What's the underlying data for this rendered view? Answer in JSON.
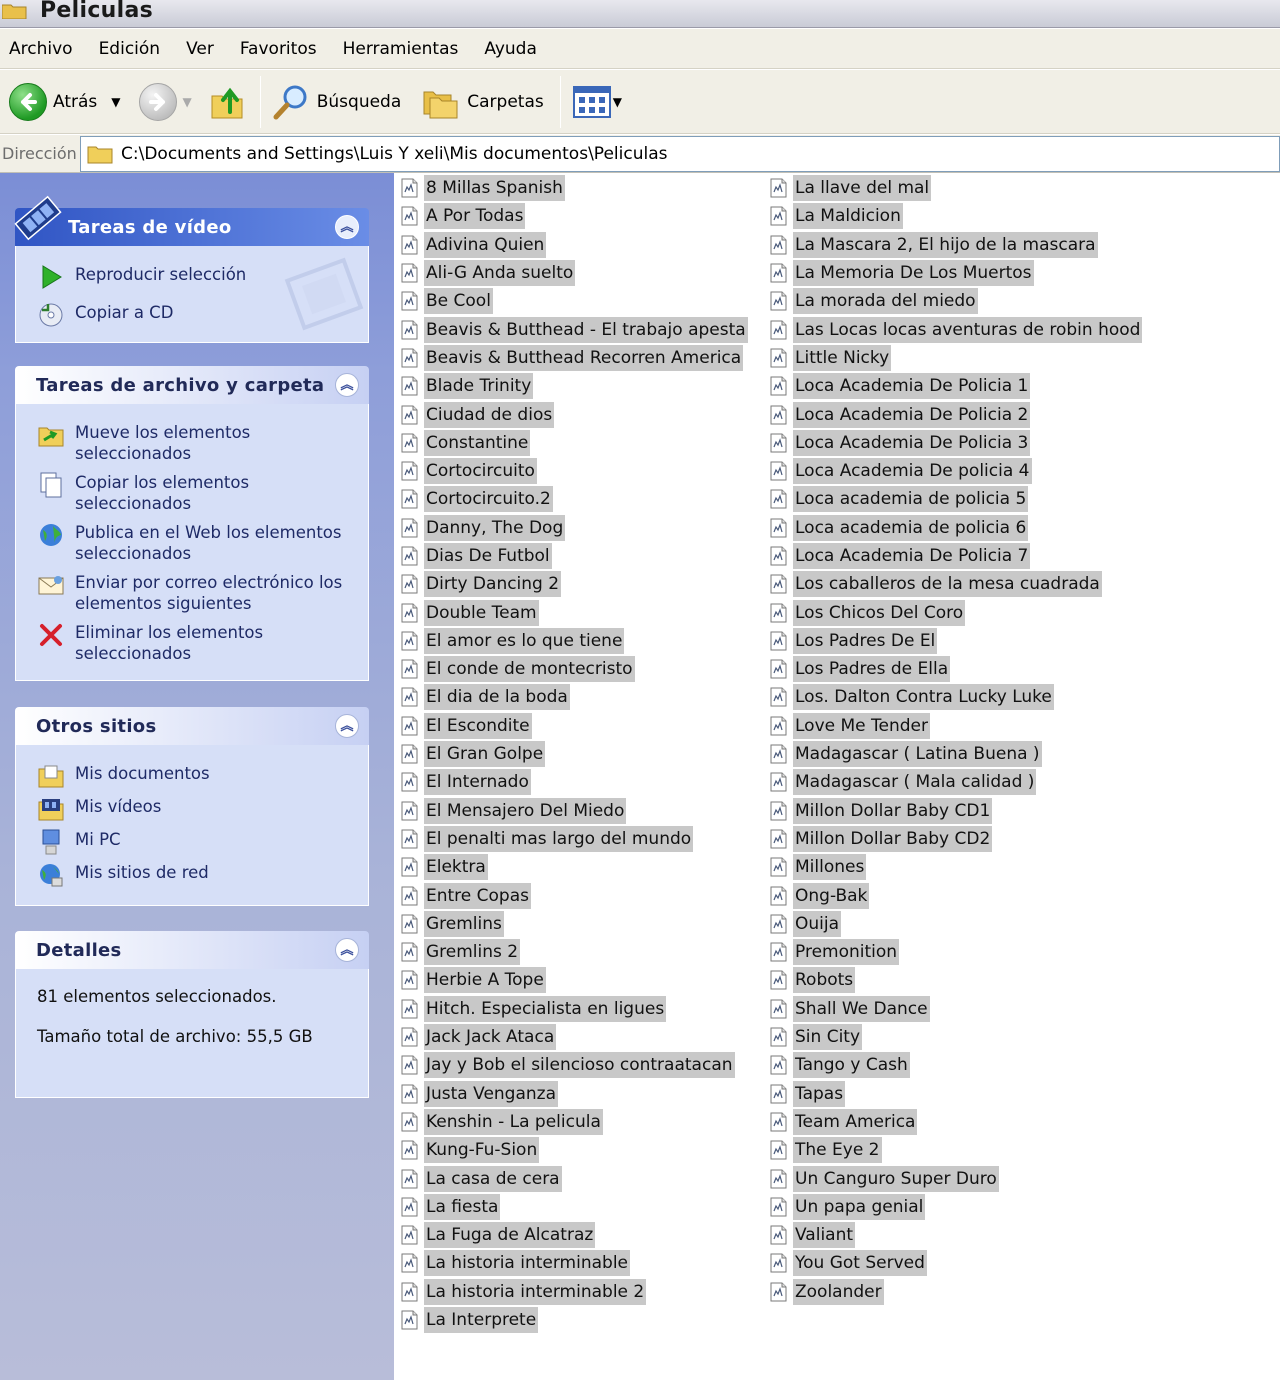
{
  "window": {
    "title": "Peliculas"
  },
  "menu": [
    "Archivo",
    "Edición",
    "Ver",
    "Favoritos",
    "Herramientas",
    "Ayuda"
  ],
  "toolbar": {
    "back_label": "Atrás",
    "search_label": "Búsqueda",
    "folders_label": "Carpetas"
  },
  "address": {
    "label": "Dirección",
    "path": "C:\\Documents and Settings\\Luis Y xeli\\Mis documentos\\Peliculas"
  },
  "panels": {
    "video": {
      "title": "Tareas de vídeo",
      "items": [
        "Reproducir selección",
        "Copiar a CD"
      ]
    },
    "file_tasks": {
      "title": "Tareas de archivo y carpeta",
      "items": [
        "Mueve los elementos seleccionados",
        "Copiar los elementos seleccionados",
        "Publica en el Web los elementos seleccionados",
        "Enviar por correo electrónico los elementos siguientes",
        "Eliminar los elementos seleccionados"
      ]
    },
    "other": {
      "title": "Otros sitios",
      "items": [
        "Mis documentos",
        "Mis vídeos",
        "Mi PC",
        "Mis sitios de red"
      ]
    },
    "details": {
      "title": "Detalles",
      "selected": "81 elementos seleccionados.",
      "total_size": "Tamaño total de archivo: 55,5 GB"
    }
  },
  "files": {
    "column1": [
      "8 Millas Spanish",
      "A Por Todas",
      "Adivina Quien",
      "Ali-G Anda suelto",
      "Be Cool",
      "Beavis & Butthead - El trabajo apesta",
      "Beavis & Butthead Recorren America",
      "Blade Trinity",
      "Ciudad de dios",
      "Constantine",
      "Cortocircuito",
      "Cortocircuito.2",
      "Danny, The Dog",
      "Dias De Futbol",
      "Dirty Dancing 2",
      "Double Team",
      "El amor es lo que tiene",
      "El conde de montecristo",
      "El dia de la boda",
      "El Escondite",
      "El Gran Golpe",
      "El Internado",
      "El Mensajero Del Miedo",
      "El penalti mas largo del mundo",
      "Elektra",
      "Entre Copas",
      "Gremlins",
      "Gremlins 2",
      "Herbie A Tope",
      "Hitch. Especialista en ligues",
      "Jack Jack Ataca",
      "Jay y Bob el silencioso contraatacan",
      "Justa Venganza",
      "Kenshin - La pelicula",
      "Kung-Fu-Sion",
      "La casa de cera",
      "La fiesta",
      "La Fuga de Alcatraz",
      "La historia interminable",
      "La historia interminable 2",
      "La Interprete"
    ],
    "column2": [
      "La llave del mal",
      "La Maldicion",
      "La Mascara 2, El hijo de la mascara",
      "La Memoria De Los Muertos",
      "La morada del miedo",
      "Las Locas locas aventuras de robin hood",
      "Little Nicky",
      "Loca Academia De Policia 1",
      "Loca Academia De Policia 2",
      "Loca Academia De Policia 3",
      "Loca Academia De policia 4",
      "Loca academia de policia 5",
      "Loca academia de policia 6",
      "Loca Academia De Policia 7",
      "Los caballeros de la mesa cuadrada",
      "Los Chicos Del Coro",
      "Los Padres De El",
      "Los Padres de Ella",
      "Los. Dalton Contra Lucky Luke",
      "Love Me Tender",
      "Madagascar ( Latina Buena )",
      "Madagascar ( Mala calidad )",
      "Millon Dollar Baby CD1",
      "Millon Dollar Baby CD2",
      "Millones",
      "Ong-Bak",
      "Ouija",
      "Premonition",
      "Robots",
      "Shall We Dance",
      "Sin City",
      "Tango y Cash",
      "Tapas",
      "Team America",
      "The Eye 2",
      "Un Canguro Super Duro",
      "Un papa genial",
      "Valiant",
      "You Got Served",
      "Zoolander"
    ]
  }
}
